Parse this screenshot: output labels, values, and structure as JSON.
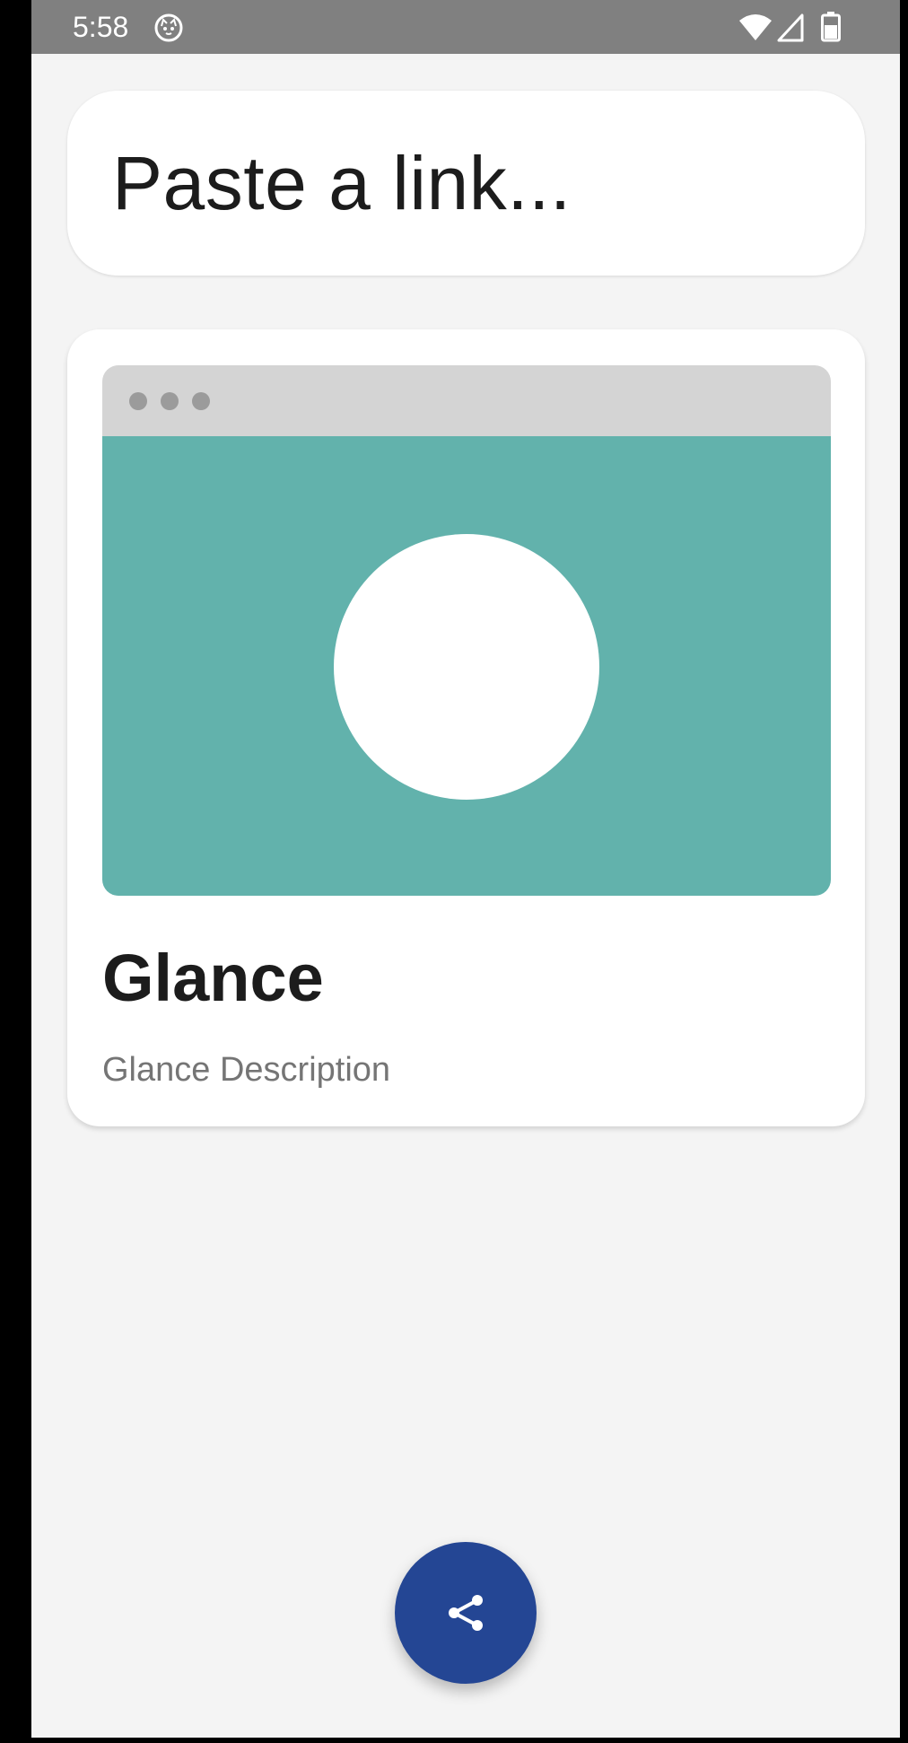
{
  "status_bar": {
    "time": "5:58",
    "icons": [
      "cat-notification-icon",
      "wifi-icon",
      "cell-signal-icon",
      "battery-icon"
    ]
  },
  "search": {
    "placeholder": "Paste a link..."
  },
  "preview_card": {
    "title": "Glance",
    "description": "Glance Description",
    "image_colors": {
      "browser_bar": "#d4d4d4",
      "browser_dots": "#9b9b9b",
      "image_background": "#62b2ac",
      "circle": "#ffffff"
    }
  },
  "fab": {
    "icon": "share-icon",
    "color": "#244694"
  },
  "colors": {
    "status_bar": "#808080",
    "background": "#f4f4f4"
  }
}
